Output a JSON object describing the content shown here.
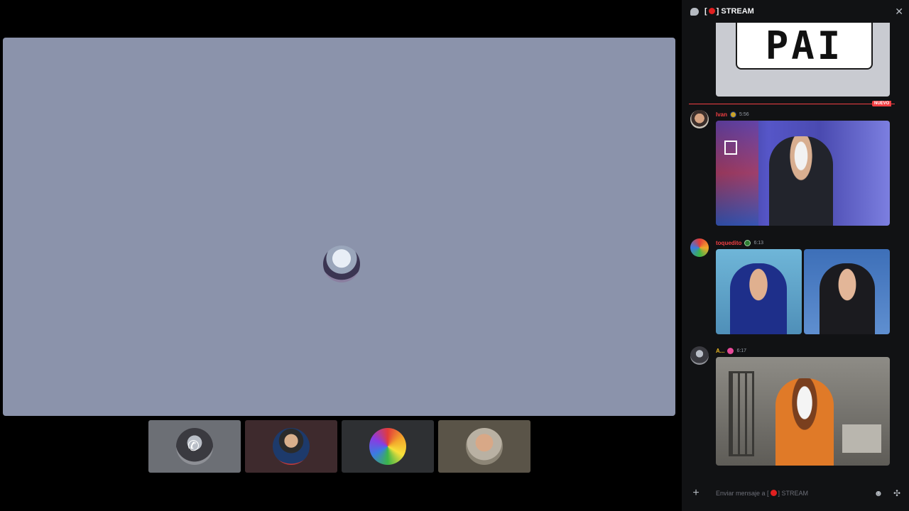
{
  "header": {
    "title_prefix": "[",
    "title_suffix": "] STREAM",
    "chat_icon": "chat-bubble-icon",
    "close_icon": "close-icon"
  },
  "main": {
    "avatar_icon": "user-avatar"
  },
  "thumbnails": [
    {
      "name": "participant-1",
      "bg": "#6c6f75",
      "phone_icon": "phone-icon"
    },
    {
      "name": "participant-2",
      "bg": "#3e2a2d"
    },
    {
      "name": "participant-3",
      "bg": "#2e3033"
    },
    {
      "name": "participant-4",
      "bg": "#5a5448"
    }
  ],
  "messages": {
    "first_image_text": "PAI",
    "new_tag": "NUEVO",
    "m1": {
      "username": "Ivan",
      "username_color": "#f23f43",
      "time": "5:56"
    },
    "m2": {
      "username": "toquedito",
      "username_color": "#f23f43",
      "time": "6:13"
    },
    "m3": {
      "username": "A...",
      "username_color": "#e6b422",
      "time": "6:17"
    }
  },
  "composer": {
    "placeholder_prefix": "Enviar mensaje a [",
    "placeholder_suffix": "] STREAM",
    "plus_icon": "plus-icon",
    "emoji_icon": "emoji-icon",
    "apps_icon": "apps-icon"
  },
  "colors": {
    "main_tile": "#8b93ab",
    "panel_bg": "#111214",
    "new_line": "#f23f43"
  }
}
